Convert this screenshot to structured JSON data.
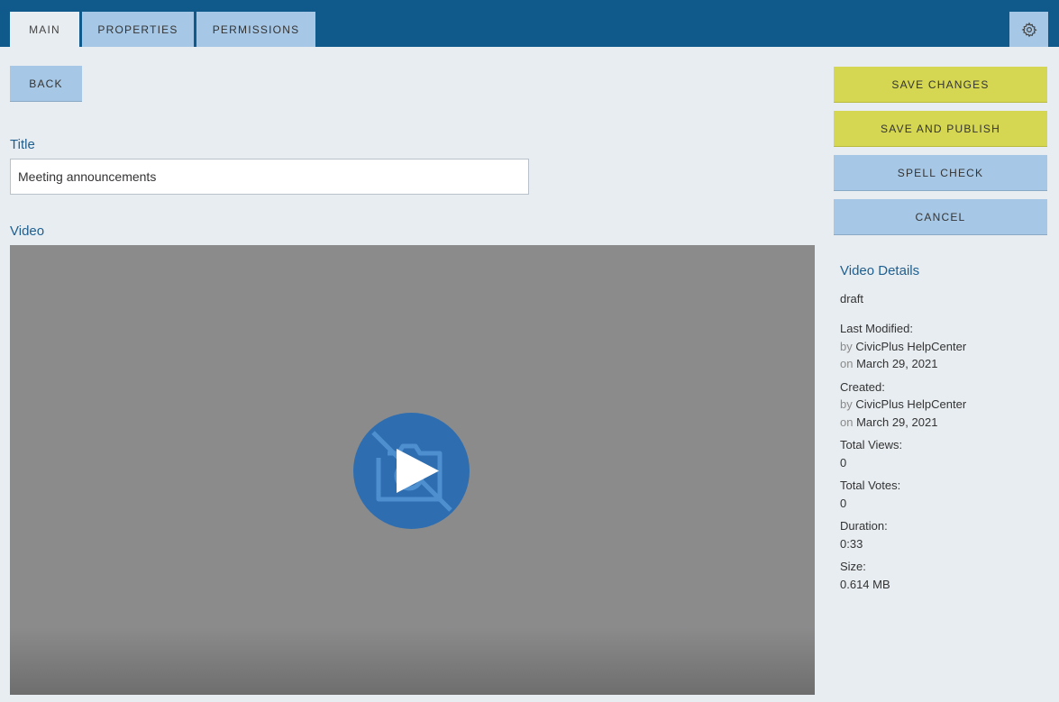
{
  "tabs": [
    {
      "label": "MAIN",
      "active": true
    },
    {
      "label": "PROPERTIES",
      "active": false
    },
    {
      "label": "PERMISSIONS",
      "active": false
    }
  ],
  "settings_icon": "gear-icon",
  "toolbar": {
    "back_label": "BACK",
    "save_changes_label": "SAVE CHANGES",
    "save_publish_label": "SAVE AND PUBLISH",
    "spell_check_label": "SPELL CHECK",
    "cancel_label": "CANCEL"
  },
  "form": {
    "title_label": "Title",
    "title_value": "Meeting announcements",
    "video_label": "Video"
  },
  "video_player": {
    "overlay_icon": "play-icon",
    "background_icon": "video-off-icon"
  },
  "details": {
    "heading": "Video Details",
    "status": "draft",
    "last_modified_label": "Last Modified:",
    "last_modified_by_prefix": "by",
    "last_modified_by": "CivicPlus HelpCenter",
    "last_modified_on_prefix": "on",
    "last_modified_on": "March 29, 2021",
    "created_label": "Created:",
    "created_by_prefix": "by",
    "created_by": "CivicPlus HelpCenter",
    "created_on_prefix": "on",
    "created_on": "March 29, 2021",
    "total_views_label": "Total Views:",
    "total_views": "0",
    "total_votes_label": "Total Votes:",
    "total_votes": "0",
    "duration_label": "Duration:",
    "duration": "0:33",
    "size_label": "Size:",
    "size": "0.614 MB"
  },
  "colors": {
    "topbar": "#0f5a8b",
    "tab_inactive": "#a6c7e5",
    "button_primary": "#d5d753",
    "accent_text": "#1f5f8f",
    "play_button": "#2e6eb0"
  }
}
